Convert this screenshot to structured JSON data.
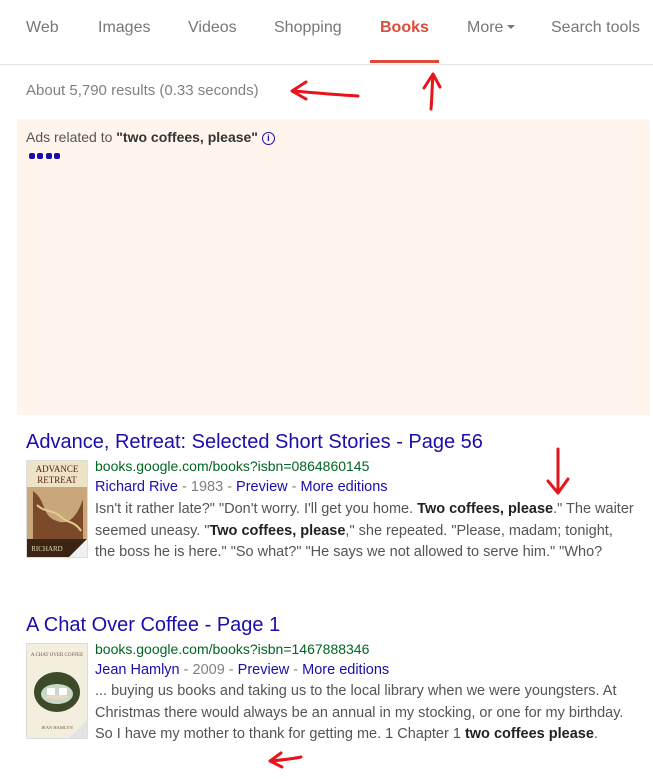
{
  "tabs": {
    "web": "Web",
    "images": "Images",
    "videos": "Videos",
    "shopping": "Shopping",
    "books": "Books",
    "more": "More",
    "search_tools": "Search tools",
    "active": "Books"
  },
  "stats": "About 5,790 results (0.33 seconds)",
  "ads": {
    "prefix": "Ads related to ",
    "query": "\"two coffees, please\"",
    "info_icon": "info-icon"
  },
  "results": [
    {
      "title": "Advance, Retreat: Selected Short Stories - Page 56",
      "url": "books.google.com/books?isbn=0864860145",
      "author": "Richard Rive",
      "year": "1983",
      "preview": "Preview",
      "more_editions": "More editions",
      "snippet": {
        "t1": "Isn't it rather late?\" \"Don't worry. I'll get you home. ",
        "b1": "Two coffees, please",
        "t2": ".\" The waiter seemed uneasy. \"",
        "b2": "Two coffees, please",
        "t3": ",\" she repeated. \"Please, madam; tonight, the boss he is here.\" \"So what?\" \"He says we not allowed to serve him.\" \"Who?"
      },
      "cover": {
        "top_text": "ADVANCE, RETREAT",
        "bottom_text": "RICHARD"
      }
    },
    {
      "title": "A Chat Over Coffee - Page 1",
      "url": "books.google.com/books?isbn=1467888346",
      "author": "Jean Hamlyn",
      "year": "2009",
      "preview": "Preview",
      "more_editions": "More editions",
      "snippet": {
        "t1": "... buying us books and taking us to the local library when we were youngsters. At Christmas there would always be an annual in my stocking, or one for my birthday. So I have my mother to thank for getting me. 1 Chapter 1 ",
        "b1": "two coffees please",
        "t2": "."
      },
      "cover": {
        "top_text": "A CHAT OVER COFFEE",
        "bottom_text": "JEAN HAMLYN"
      }
    }
  ],
  "colors": {
    "accent_red": "#dd4b39",
    "link_blue": "#1a0dab",
    "url_green": "#006621",
    "ads_bg": "#fff5ec",
    "annotation_red": "#e8141b"
  }
}
